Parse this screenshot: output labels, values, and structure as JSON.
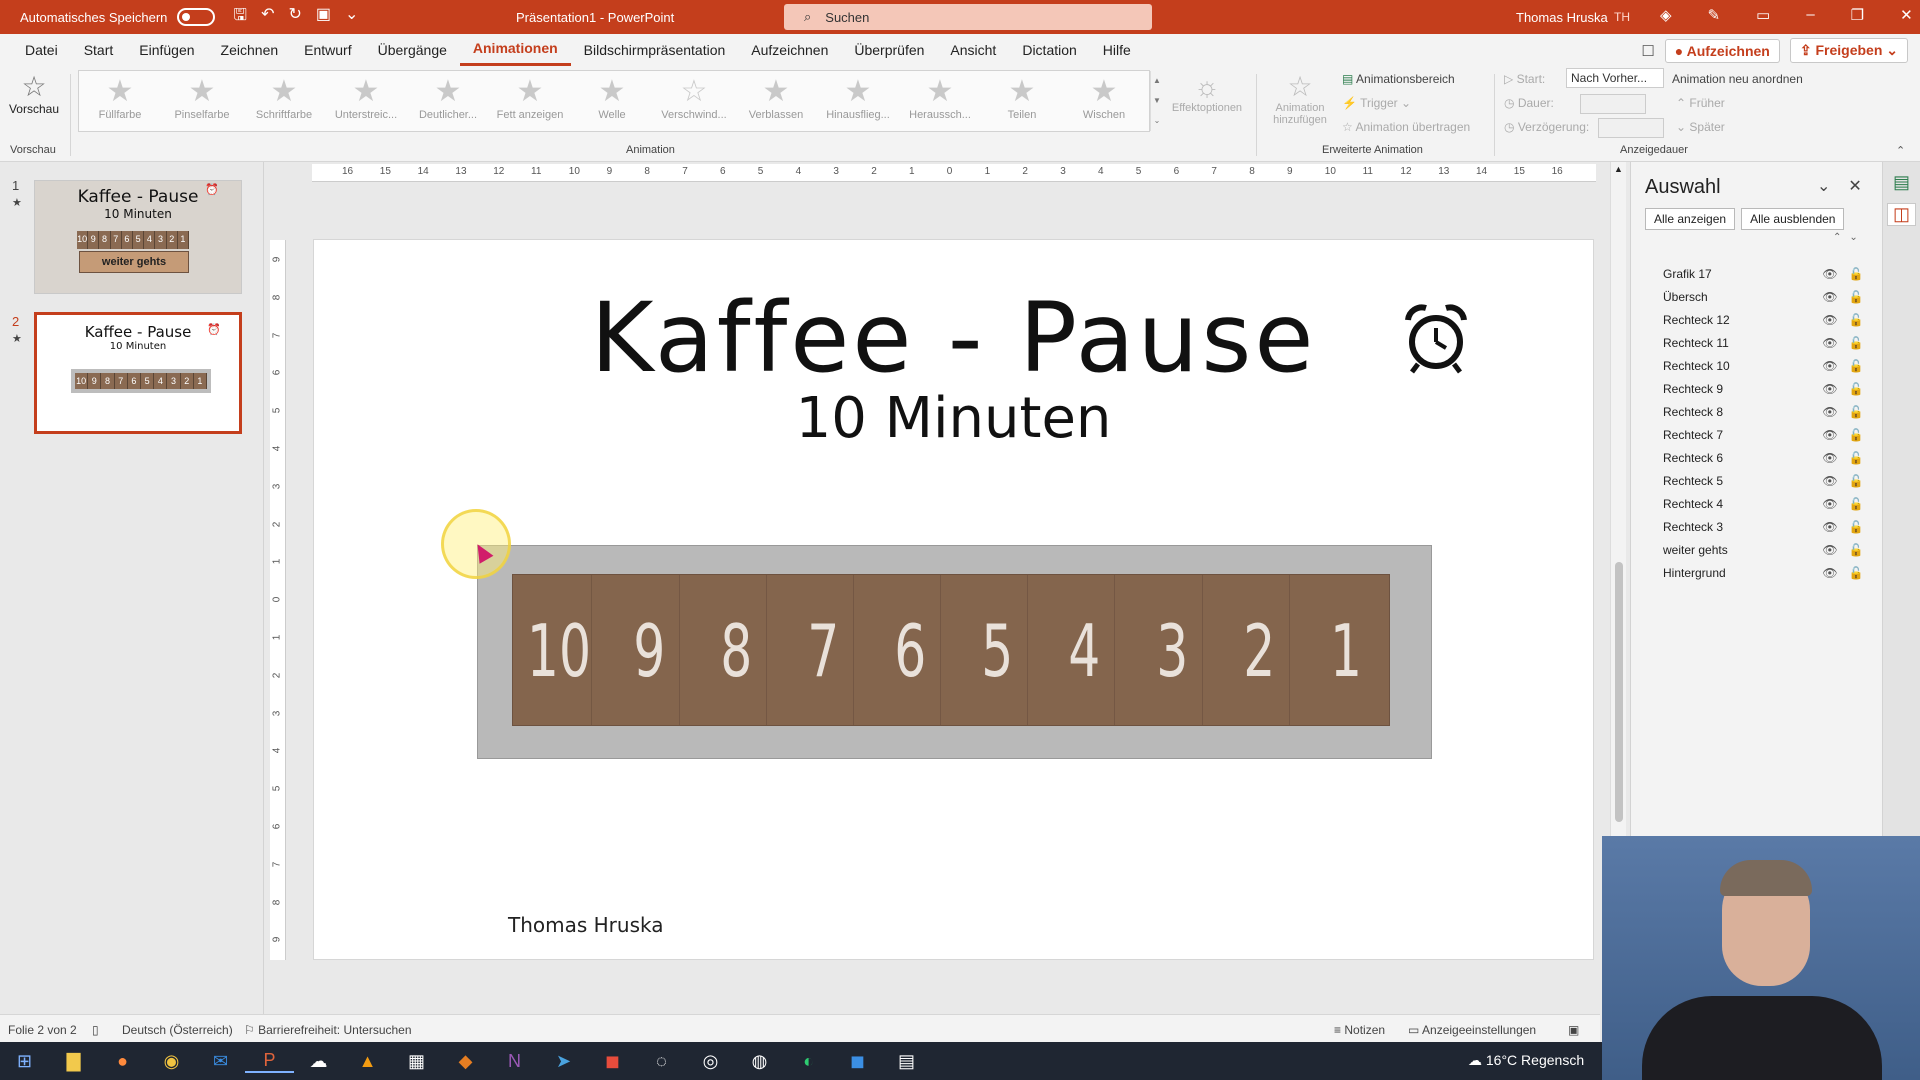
{
  "titlebar": {
    "autosave_label": "Automatisches Speichern",
    "doc_title": "Präsentation1 - PowerPoint",
    "search_label": "Suchen",
    "user_name": "Thomas Hruska",
    "user_initials": "TH"
  },
  "menu": {
    "items": [
      "Datei",
      "Start",
      "Einfügen",
      "Zeichnen",
      "Entwurf",
      "Übergänge",
      "Animationen",
      "Bildschirmpräsentation",
      "Aufzeichnen",
      "Überprüfen",
      "Ansicht",
      "Dictation",
      "Hilfe"
    ],
    "active": "Animationen",
    "record_label": "Aufzeichnen",
    "share_label": "Freigeben"
  },
  "ribbon": {
    "preview_label": "Vorschau",
    "preview_group": "Vorschau",
    "animation_group": "Animation",
    "effects": [
      "Füllfarbe",
      "Pinselfarbe",
      "Schriftfarbe",
      "Unterstreic...",
      "Deutlicher...",
      "Fett anzeigen",
      "Welle",
      "Verschwind...",
      "Verblassen",
      "Hinausflieg...",
      "Heraussch...",
      "Teilen",
      "Wischen"
    ],
    "effect_options_label": "Effektoptionen",
    "add_animation_label": "Animation hinzufügen",
    "animation_pane_label": "Animationsbereich",
    "trigger_label": "Trigger",
    "copy_animation_label": "Animation übertragen",
    "advanced_group": "Erweiterte Animation",
    "start_label": "Start:",
    "start_value": "Nach Vorher...",
    "duration_label": "Dauer:",
    "delay_label": "Verzögerung:",
    "timing_group": "Anzeigedauer",
    "reorder_label": "Animation neu anordnen",
    "earlier_label": "Früher",
    "later_label": "Später"
  },
  "thumbnails": [
    {
      "number": "1",
      "title": "Kaffee - Pause",
      "subtitle": "10 Minuten",
      "caption": "weiter gehts"
    },
    {
      "number": "2",
      "title": "Kaffee - Pause",
      "subtitle": "10 Minuten"
    }
  ],
  "ruler": {
    "horizontal": [
      "16",
      "15",
      "14",
      "13",
      "12",
      "11",
      "10",
      "9",
      "8",
      "7",
      "6",
      "5",
      "4",
      "3",
      "2",
      "1",
      "0",
      "1",
      "2",
      "3",
      "4",
      "5",
      "6",
      "7",
      "8",
      "9",
      "10",
      "11",
      "12",
      "13",
      "14",
      "15",
      "16"
    ],
    "vertical": [
      "9",
      "8",
      "7",
      "6",
      "5",
      "4",
      "3",
      "2",
      "1",
      "0",
      "1",
      "2",
      "3",
      "4",
      "5",
      "6",
      "7",
      "8",
      "9"
    ]
  },
  "slide": {
    "title": "Kaffee - Pause",
    "subtitle": "10 Minuten",
    "counter": [
      "10",
      "9",
      "8",
      "7",
      "6",
      "5",
      "4",
      "3",
      "2",
      "1"
    ],
    "author": "Thomas Hruska"
  },
  "selection_pane": {
    "title": "Auswahl",
    "show_all": "Alle anzeigen",
    "hide_all": "Alle ausblenden",
    "items": [
      "Grafik 17",
      "Übersch",
      "Rechteck 12",
      "Rechteck 11",
      "Rechteck 10",
      "Rechteck 9",
      "Rechteck 8",
      "Rechteck 7",
      "Rechteck 6",
      "Rechteck 5",
      "Rechteck 4",
      "Rechteck 3",
      "weiter gehts",
      "Hintergrund"
    ]
  },
  "statusbar": {
    "slide_info": "Folie 2 von 2",
    "language": "Deutsch (Österreich)",
    "accessibility": "Barrierefreiheit: Untersuchen",
    "notes": "Notizen",
    "display_settings": "Anzeigeeinstellungen"
  },
  "taskbar": {
    "weather": "16°C Regensch"
  },
  "colors": {
    "accent": "#c43e1c",
    "counter_fill": "#84654d",
    "counter_frame": "#b9b9b9"
  }
}
